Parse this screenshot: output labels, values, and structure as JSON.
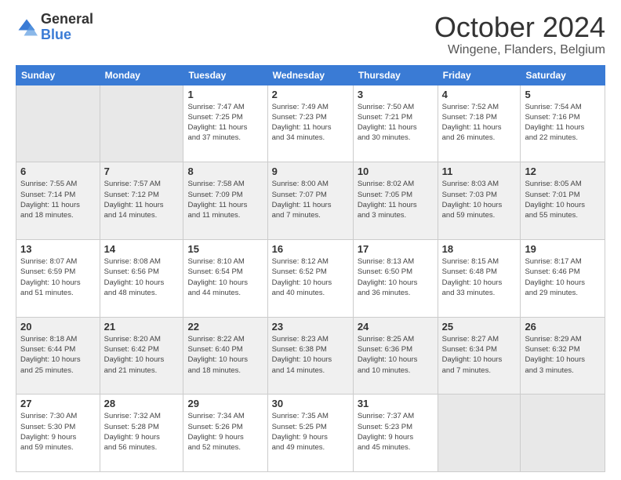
{
  "header": {
    "logo_general": "General",
    "logo_blue": "Blue",
    "month_title": "October 2024",
    "location": "Wingene, Flanders, Belgium"
  },
  "days_of_week": [
    "Sunday",
    "Monday",
    "Tuesday",
    "Wednesday",
    "Thursday",
    "Friday",
    "Saturday"
  ],
  "weeks": [
    [
      {
        "day": "",
        "info": ""
      },
      {
        "day": "",
        "info": ""
      },
      {
        "day": "1",
        "info": "Sunrise: 7:47 AM\nSunset: 7:25 PM\nDaylight: 11 hours\nand 37 minutes."
      },
      {
        "day": "2",
        "info": "Sunrise: 7:49 AM\nSunset: 7:23 PM\nDaylight: 11 hours\nand 34 minutes."
      },
      {
        "day": "3",
        "info": "Sunrise: 7:50 AM\nSunset: 7:21 PM\nDaylight: 11 hours\nand 30 minutes."
      },
      {
        "day": "4",
        "info": "Sunrise: 7:52 AM\nSunset: 7:18 PM\nDaylight: 11 hours\nand 26 minutes."
      },
      {
        "day": "5",
        "info": "Sunrise: 7:54 AM\nSunset: 7:16 PM\nDaylight: 11 hours\nand 22 minutes."
      }
    ],
    [
      {
        "day": "6",
        "info": "Sunrise: 7:55 AM\nSunset: 7:14 PM\nDaylight: 11 hours\nand 18 minutes."
      },
      {
        "day": "7",
        "info": "Sunrise: 7:57 AM\nSunset: 7:12 PM\nDaylight: 11 hours\nand 14 minutes."
      },
      {
        "day": "8",
        "info": "Sunrise: 7:58 AM\nSunset: 7:09 PM\nDaylight: 11 hours\nand 11 minutes."
      },
      {
        "day": "9",
        "info": "Sunrise: 8:00 AM\nSunset: 7:07 PM\nDaylight: 11 hours\nand 7 minutes."
      },
      {
        "day": "10",
        "info": "Sunrise: 8:02 AM\nSunset: 7:05 PM\nDaylight: 11 hours\nand 3 minutes."
      },
      {
        "day": "11",
        "info": "Sunrise: 8:03 AM\nSunset: 7:03 PM\nDaylight: 10 hours\nand 59 minutes."
      },
      {
        "day": "12",
        "info": "Sunrise: 8:05 AM\nSunset: 7:01 PM\nDaylight: 10 hours\nand 55 minutes."
      }
    ],
    [
      {
        "day": "13",
        "info": "Sunrise: 8:07 AM\nSunset: 6:59 PM\nDaylight: 10 hours\nand 51 minutes."
      },
      {
        "day": "14",
        "info": "Sunrise: 8:08 AM\nSunset: 6:56 PM\nDaylight: 10 hours\nand 48 minutes."
      },
      {
        "day": "15",
        "info": "Sunrise: 8:10 AM\nSunset: 6:54 PM\nDaylight: 10 hours\nand 44 minutes."
      },
      {
        "day": "16",
        "info": "Sunrise: 8:12 AM\nSunset: 6:52 PM\nDaylight: 10 hours\nand 40 minutes."
      },
      {
        "day": "17",
        "info": "Sunrise: 8:13 AM\nSunset: 6:50 PM\nDaylight: 10 hours\nand 36 minutes."
      },
      {
        "day": "18",
        "info": "Sunrise: 8:15 AM\nSunset: 6:48 PM\nDaylight: 10 hours\nand 33 minutes."
      },
      {
        "day": "19",
        "info": "Sunrise: 8:17 AM\nSunset: 6:46 PM\nDaylight: 10 hours\nand 29 minutes."
      }
    ],
    [
      {
        "day": "20",
        "info": "Sunrise: 8:18 AM\nSunset: 6:44 PM\nDaylight: 10 hours\nand 25 minutes."
      },
      {
        "day": "21",
        "info": "Sunrise: 8:20 AM\nSunset: 6:42 PM\nDaylight: 10 hours\nand 21 minutes."
      },
      {
        "day": "22",
        "info": "Sunrise: 8:22 AM\nSunset: 6:40 PM\nDaylight: 10 hours\nand 18 minutes."
      },
      {
        "day": "23",
        "info": "Sunrise: 8:23 AM\nSunset: 6:38 PM\nDaylight: 10 hours\nand 14 minutes."
      },
      {
        "day": "24",
        "info": "Sunrise: 8:25 AM\nSunset: 6:36 PM\nDaylight: 10 hours\nand 10 minutes."
      },
      {
        "day": "25",
        "info": "Sunrise: 8:27 AM\nSunset: 6:34 PM\nDaylight: 10 hours\nand 7 minutes."
      },
      {
        "day": "26",
        "info": "Sunrise: 8:29 AM\nSunset: 6:32 PM\nDaylight: 10 hours\nand 3 minutes."
      }
    ],
    [
      {
        "day": "27",
        "info": "Sunrise: 7:30 AM\nSunset: 5:30 PM\nDaylight: 9 hours\nand 59 minutes."
      },
      {
        "day": "28",
        "info": "Sunrise: 7:32 AM\nSunset: 5:28 PM\nDaylight: 9 hours\nand 56 minutes."
      },
      {
        "day": "29",
        "info": "Sunrise: 7:34 AM\nSunset: 5:26 PM\nDaylight: 9 hours\nand 52 minutes."
      },
      {
        "day": "30",
        "info": "Sunrise: 7:35 AM\nSunset: 5:25 PM\nDaylight: 9 hours\nand 49 minutes."
      },
      {
        "day": "31",
        "info": "Sunrise: 7:37 AM\nSunset: 5:23 PM\nDaylight: 9 hours\nand 45 minutes."
      },
      {
        "day": "",
        "info": ""
      },
      {
        "day": "",
        "info": ""
      }
    ]
  ]
}
